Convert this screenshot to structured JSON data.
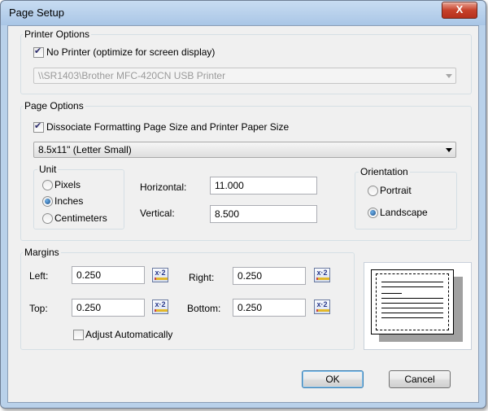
{
  "window": {
    "title": "Page Setup",
    "close_label": "X"
  },
  "printer_options": {
    "legend": "Printer Options",
    "no_printer_label": "No Printer (optimize for screen display)",
    "no_printer_checked": true,
    "printer_value": "\\\\SR1403\\Brother MFC-420CN USB Printer"
  },
  "page_options": {
    "legend": "Page Options",
    "dissociate_label": "Dissociate Formatting Page Size and Printer Paper Size",
    "dissociate_checked": true,
    "paper_size_value": "8.5x11\" (Letter Small)",
    "unit": {
      "legend": "Unit",
      "options": [
        "Pixels",
        "Inches",
        "Centimeters"
      ],
      "selected": "Inches"
    },
    "horizontal_label": "Horizontal:",
    "horizontal_value": "11.000",
    "vertical_label": "Vertical:",
    "vertical_value": "8.500",
    "orientation": {
      "legend": "Orientation",
      "options": [
        "Portrait",
        "Landscape"
      ],
      "selected": "Landscape"
    }
  },
  "margins": {
    "legend": "Margins",
    "left_label": "Left:",
    "left_value": "0.250",
    "right_label": "Right:",
    "right_value": "0.250",
    "top_label": "Top:",
    "top_value": "0.250",
    "bottom_label": "Bottom:",
    "bottom_value": "0.250",
    "calc_label": "x·2",
    "adjust_label": "Adjust Automatically",
    "adjust_checked": false
  },
  "buttons": {
    "ok": "OK",
    "cancel": "Cancel"
  },
  "icons": {
    "close": "close-icon",
    "calculator": "calculator-icon",
    "dropdown": "chevron-down-icon"
  },
  "colors": {
    "window_frame": "#b9d1ea",
    "close_button": "#c7412b",
    "dialog_bg": "#f0f0f0"
  }
}
